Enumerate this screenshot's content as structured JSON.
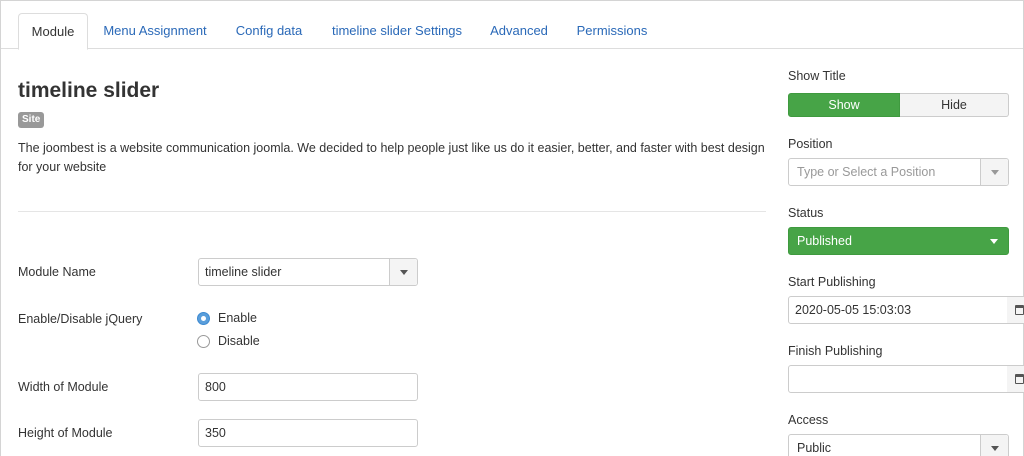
{
  "tabs": [
    "Module",
    "Menu Assignment",
    "Config data",
    "timeline slider Settings",
    "Advanced",
    "Permissions"
  ],
  "module": {
    "title": "timeline slider",
    "badge": "Site",
    "description": "The joombest is a website communication joomla. We decided to help people just like us do it easier, better, and faster with best design for your website"
  },
  "fields": {
    "module_name_label": "Module Name",
    "module_name_value": "timeline slider",
    "jquery_label": "Enable/Disable jQuery",
    "jquery_options": [
      "Enable",
      "Disable"
    ],
    "jquery_selected": "Enable",
    "width_label": "Width of Module",
    "width_value": "800",
    "height_label": "Height of Module",
    "height_value": "350"
  },
  "sidebar": {
    "show_title_label": "Show Title",
    "show_label": "Show",
    "hide_label": "Hide",
    "position_label": "Position",
    "position_placeholder": "Type or Select a Position",
    "status_label": "Status",
    "status_value": "Published",
    "start_publishing_label": "Start Publishing",
    "start_publishing_value": "2020-05-05 15:03:03",
    "finish_publishing_label": "Finish Publishing",
    "finish_publishing_value": "",
    "access_label": "Access",
    "access_value": "Public"
  },
  "colors": {
    "link": "#2a69b8",
    "success": "#47a447",
    "badge": "#999999",
    "radio_checked": "#5a9edb"
  }
}
